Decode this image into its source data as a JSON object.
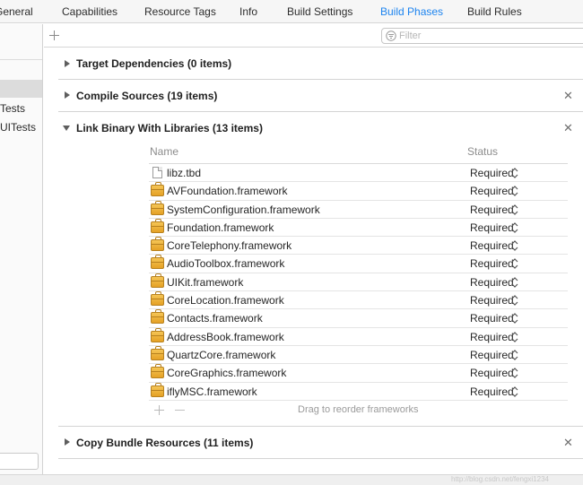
{
  "tabs": [
    {
      "label": "General",
      "active": false
    },
    {
      "label": "Capabilities",
      "active": false
    },
    {
      "label": "Resource Tags",
      "active": false
    },
    {
      "label": "Info",
      "active": false
    },
    {
      "label": "Build Settings",
      "active": false
    },
    {
      "label": "Build Phases",
      "active": true
    },
    {
      "label": "Build Rules",
      "active": false
    }
  ],
  "sidebar": {
    "items": [
      "Tests",
      "UITests"
    ]
  },
  "toolbar": {
    "filter_placeholder": "Filter"
  },
  "phases": {
    "target_dependencies": {
      "title": "Target Dependencies (0 items)",
      "expanded": false
    },
    "compile_sources": {
      "title": "Compile Sources (19 items)",
      "expanded": false
    },
    "link_binary": {
      "title": "Link Binary With Libraries (13 items)",
      "expanded": true
    },
    "copy_bundle": {
      "title": "Copy Bundle Resources (11 items)",
      "expanded": false
    }
  },
  "libraries": {
    "columns": {
      "name": "Name",
      "status": "Status"
    },
    "rows": [
      {
        "name": "libz.tbd",
        "status": "Required",
        "icon": "file-icon"
      },
      {
        "name": "AVFoundation.framework",
        "status": "Required",
        "icon": "framework-icon"
      },
      {
        "name": "SystemConfiguration.framework",
        "status": "Required",
        "icon": "framework-icon"
      },
      {
        "name": "Foundation.framework",
        "status": "Required",
        "icon": "framework-icon"
      },
      {
        "name": "CoreTelephony.framework",
        "status": "Required",
        "icon": "framework-icon"
      },
      {
        "name": "AudioToolbox.framework",
        "status": "Required",
        "icon": "framework-icon"
      },
      {
        "name": "UIKit.framework",
        "status": "Required",
        "icon": "framework-icon"
      },
      {
        "name": "CoreLocation.framework",
        "status": "Required",
        "icon": "framework-icon"
      },
      {
        "name": "Contacts.framework",
        "status": "Required",
        "icon": "framework-icon"
      },
      {
        "name": "AddressBook.framework",
        "status": "Required",
        "icon": "framework-icon"
      },
      {
        "name": "QuartzCore.framework",
        "status": "Required",
        "icon": "framework-icon"
      },
      {
        "name": "CoreGraphics.framework",
        "status": "Required",
        "icon": "framework-icon"
      },
      {
        "name": "iflyMSC.framework",
        "status": "Required",
        "icon": "framework-icon"
      }
    ],
    "drag_hint": "Drag to reorder frameworks"
  },
  "watermark": "http://blog.csdn.net/fengxi1234",
  "colors": {
    "accent": "#1d84ef"
  }
}
